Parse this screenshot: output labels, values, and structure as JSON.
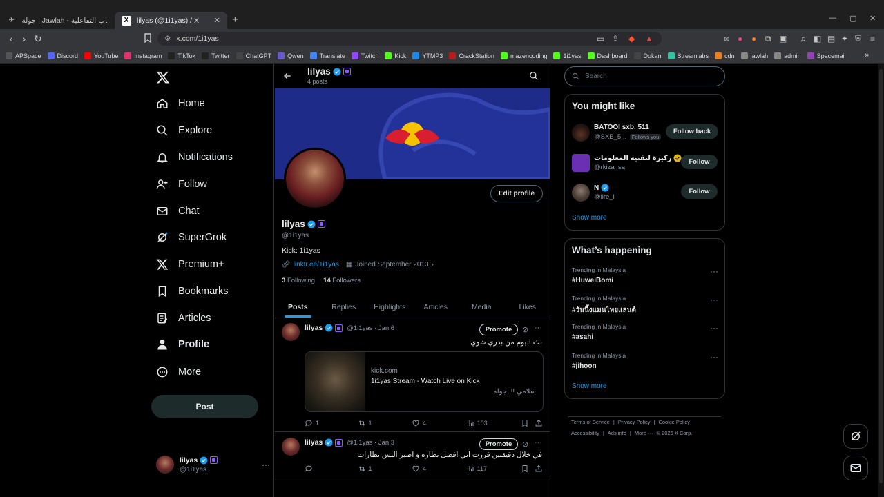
{
  "browser": {
    "tabs": [
      {
        "title": "جولة | Jawlah - منصة الألعاب التفاعلية",
        "active": false
      },
      {
        "title": "lilyas (@1i1yas) / X",
        "active": true
      }
    ],
    "url": "x.com/1i1yas",
    "new_tab": "+",
    "bookmarks": [
      {
        "label": "APSpace",
        "color": "#555"
      },
      {
        "label": "Discord",
        "color": "#5865f2"
      },
      {
        "label": "YouTube",
        "color": "#ff0000"
      },
      {
        "label": "Instagram",
        "color": "#e1306c"
      },
      {
        "label": "TikTok",
        "color": "#222"
      },
      {
        "label": "Twitter",
        "color": "#222"
      },
      {
        "label": "ChatGPT",
        "color": "#444"
      },
      {
        "label": "Qwen",
        "color": "#6a5acd"
      },
      {
        "label": "Translate",
        "color": "#4285f4"
      },
      {
        "label": "Twitch",
        "color": "#9146ff"
      },
      {
        "label": "Kick",
        "color": "#53fc18"
      },
      {
        "label": "YTMP3",
        "color": "#1e88e5"
      },
      {
        "label": "CrackStation",
        "color": "#b71c1c"
      },
      {
        "label": "mazencoding",
        "color": "#53fc18"
      },
      {
        "label": "1i1yas",
        "color": "#53fc18"
      },
      {
        "label": "Dashboard",
        "color": "#53fc18"
      },
      {
        "label": "Dokan",
        "color": "#444"
      },
      {
        "label": "Streamlabs",
        "color": "#31c3a2"
      },
      {
        "label": "cdn",
        "color": "#e67e22"
      },
      {
        "label": "jawlah",
        "color": "#888"
      },
      {
        "label": "admin",
        "color": "#888"
      },
      {
        "label": "Spacemail",
        "color": "#8e44ad"
      }
    ],
    "more_bookmarks": "»"
  },
  "nav": {
    "items": [
      {
        "label": "Home",
        "icon": "home-icon"
      },
      {
        "label": "Explore",
        "icon": "search-icon"
      },
      {
        "label": "Notifications",
        "icon": "bell-icon"
      },
      {
        "label": "Follow",
        "icon": "person-plus-icon"
      },
      {
        "label": "Chat",
        "icon": "mail-icon"
      },
      {
        "label": "SuperGrok",
        "icon": "grok-icon"
      },
      {
        "label": "Premium+",
        "icon": "x-icon"
      },
      {
        "label": "Bookmarks",
        "icon": "bookmark-icon"
      },
      {
        "label": "Articles",
        "icon": "article-icon"
      },
      {
        "label": "Profile",
        "icon": "person-icon"
      },
      {
        "label": "More",
        "icon": "more-circle-icon"
      }
    ],
    "post_label": "Post",
    "account": {
      "name": "lilyas",
      "handle": "@1i1yas",
      "more": "···"
    }
  },
  "profile": {
    "header_name": "lilyas",
    "post_count": "4 posts",
    "name": "lilyas",
    "handle": "@1i1yas",
    "edit_label": "Edit profile",
    "bio": "Kick: 1i1yas",
    "link": "linktr.ee/1i1yas",
    "joined": "Joined September 2013",
    "following_count": "3",
    "following_label": "Following",
    "followers_count": "14",
    "followers_label": "Followers",
    "tabs": [
      "Posts",
      "Replies",
      "Highlights",
      "Articles",
      "Media",
      "Likes"
    ],
    "active_tab": "Posts"
  },
  "posts": [
    {
      "name": "lilyas",
      "meta": "@1i1yas · Jan 6",
      "text": "بث اليوم من بدري شوي",
      "promote": "Promote",
      "card": {
        "domain": "kick.com",
        "title": "1i1yas Stream - Watch Live on Kick",
        "desc": "سلامي !! اجوله"
      },
      "replies": "1",
      "reposts": "1",
      "likes": "4",
      "views": "103"
    },
    {
      "name": "lilyas",
      "meta": "@1i1yas · Jan 3",
      "text": "في خلال دقيقتين قررت اني افصل نظاره و اصير البس نظارات",
      "promote": "Promote",
      "replies": "",
      "reposts": "1",
      "likes": "4",
      "views": "117"
    }
  ],
  "sidebar": {
    "search_placeholder": "Search",
    "wtf_title": "You might like",
    "who_to_follow": [
      {
        "name": "BATOOI sxb. 511",
        "handle": "@SXB_5...",
        "follows_you": "Follows you",
        "button": "Follow back",
        "verified": false
      },
      {
        "name": "ركيزة لتقنية المعلومات",
        "handle": "@rkiza_sa",
        "button": "Follow",
        "verified": true,
        "badge_color": "#e2b719"
      },
      {
        "name": "N",
        "handle": "@llre_l",
        "button": "Follow",
        "verified": true,
        "badge_color": "#1d9bf0"
      }
    ],
    "show_more": "Show more",
    "trends_title": "What’s happening",
    "trends": [
      {
        "meta": "Trending in Malaysia",
        "tag": "#HuweiBomi"
      },
      {
        "meta": "Trending in Malaysia",
        "tag": "#วันนี้งแมนไทยแลนด์"
      },
      {
        "meta": "Trending in Malaysia",
        "tag": "#asahi"
      },
      {
        "meta": "Trending in Malaysia",
        "tag": "#jihoon"
      }
    ],
    "trends_show_more": "Show more",
    "footer": [
      "Terms of Service",
      "Privacy Policy",
      "Cookie Policy",
      "Accessibility",
      "Ads info",
      "More ···",
      "© 2026 X Corp."
    ]
  },
  "colors": {
    "accent": "#1d9bf0",
    "banner": "#1e2b89",
    "gold_badge": "#e2b719",
    "grok_badge": "#8b5cf6"
  }
}
